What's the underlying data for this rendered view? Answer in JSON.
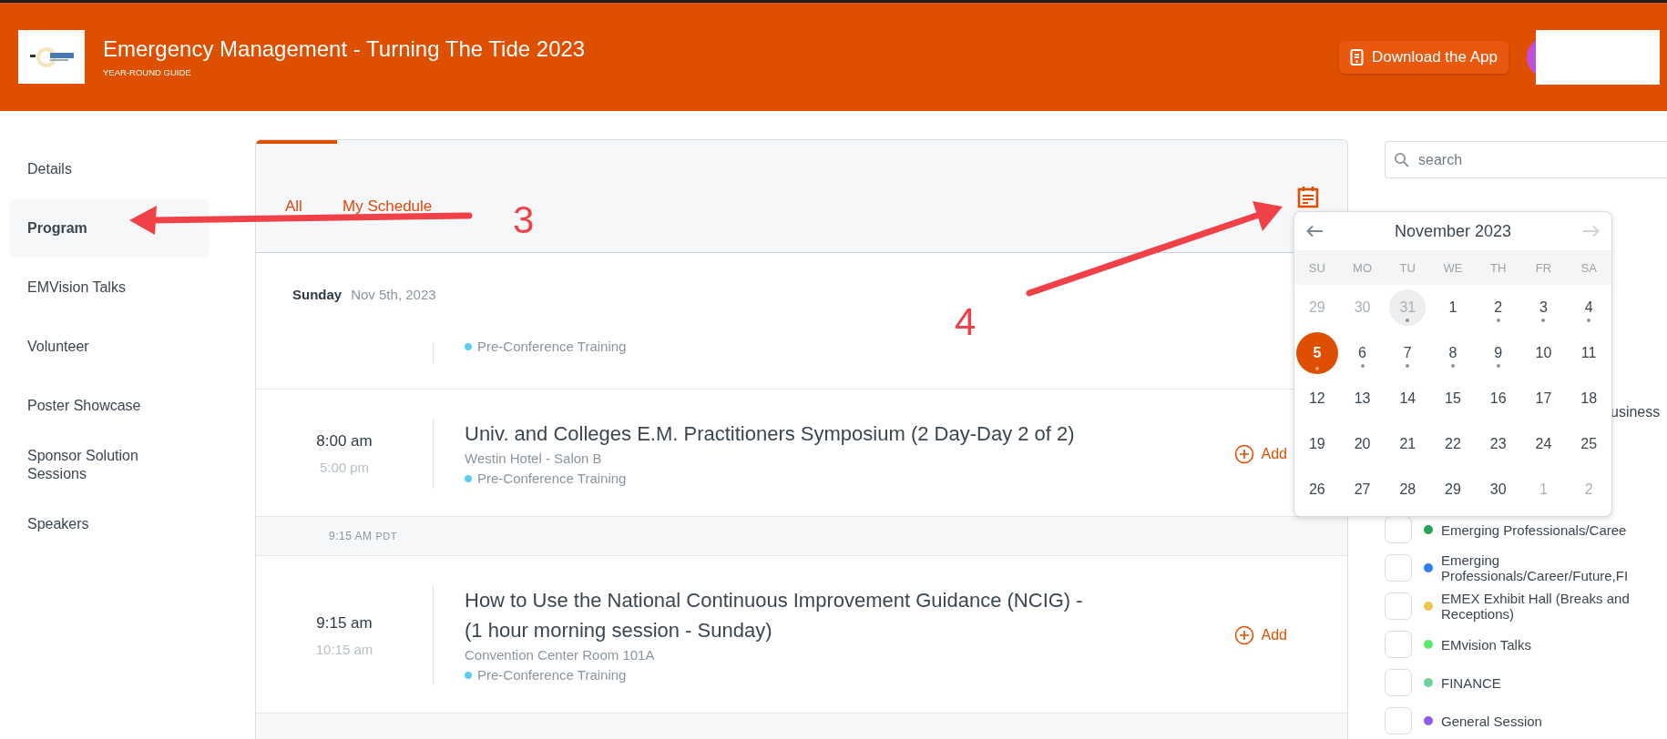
{
  "header": {
    "title": "Emergency Management - Turning The Tide 2023",
    "subtitle": "YEAR-ROUND GUIDE",
    "download_button": "Download the App"
  },
  "sidebar": {
    "items": [
      {
        "label": "Details",
        "selected": false
      },
      {
        "label": "Program",
        "selected": true
      },
      {
        "label": "EMVision Talks",
        "selected": false
      },
      {
        "label": "Volunteer",
        "selected": false
      },
      {
        "label": "Poster Showcase",
        "selected": false
      },
      {
        "label": "Sponsor Solution Sessions",
        "selected": false
      },
      {
        "label": "Speakers",
        "selected": false
      }
    ]
  },
  "tabs": [
    {
      "label": "All",
      "selected": true
    },
    {
      "label": "My Schedule",
      "selected": false
    }
  ],
  "schedule": {
    "day": "Sunday",
    "date": "Nov 5th, 2023",
    "items": [
      {
        "kind": "partial",
        "category": "Pre-Conference Training",
        "color": "#5bcfee"
      },
      {
        "kind": "session",
        "start": "8:00 am",
        "end": "5:00 pm",
        "title": "Univ. and Colleges E.M. Practitioners Symposium (2 Day-Day 2 of 2)",
        "location": "Westin Hotel - Salon B",
        "category": "Pre-Conference Training",
        "color": "#5bcfee",
        "add_label": "Add"
      },
      {
        "kind": "time_marker",
        "time": "9:15 AM",
        "zone": "PDT"
      },
      {
        "kind": "session",
        "start": "9:15 am",
        "end": "10:15 am",
        "title": "How to Use the National Continuous Improvement Guidance (NCIG) - (1 hour morning session - Sunday)",
        "location": "Convention Center Room 101A",
        "category": "Pre-Conference Training",
        "color": "#5bcfee",
        "add_label": "Add"
      }
    ]
  },
  "search": {
    "placeholder": "search"
  },
  "calendar": {
    "month": "November 2023",
    "prev_disabled": false,
    "next_disabled": true,
    "weekdays": [
      "SU",
      "MO",
      "TU",
      "WE",
      "TH",
      "FR",
      "SA"
    ],
    "weeks": [
      [
        {
          "label": "29",
          "muted": true,
          "event": false,
          "selected": false,
          "highlighted": false
        },
        {
          "label": "30",
          "muted": true,
          "event": false,
          "selected": false,
          "highlighted": false
        },
        {
          "label": "31",
          "muted": true,
          "event": true,
          "selected": false,
          "highlighted": true
        },
        {
          "label": "1",
          "muted": false,
          "event": false,
          "selected": false,
          "highlighted": false
        },
        {
          "label": "2",
          "muted": false,
          "event": true,
          "selected": false,
          "highlighted": false
        },
        {
          "label": "3",
          "muted": false,
          "event": true,
          "selected": false,
          "highlighted": false
        },
        {
          "label": "4",
          "muted": false,
          "event": true,
          "selected": false,
          "highlighted": false
        }
      ],
      [
        {
          "label": "5",
          "muted": false,
          "event": true,
          "selected": true,
          "highlighted": false
        },
        {
          "label": "6",
          "muted": false,
          "event": true,
          "selected": false,
          "highlighted": false
        },
        {
          "label": "7",
          "muted": false,
          "event": true,
          "selected": false,
          "highlighted": false
        },
        {
          "label": "8",
          "muted": false,
          "event": true,
          "selected": false,
          "highlighted": false
        },
        {
          "label": "9",
          "muted": false,
          "event": true,
          "selected": false,
          "highlighted": false
        },
        {
          "label": "10",
          "muted": false,
          "event": false,
          "selected": false,
          "highlighted": false
        },
        {
          "label": "11",
          "muted": false,
          "event": false,
          "selected": false,
          "highlighted": false
        }
      ],
      [
        {
          "label": "12",
          "muted": false,
          "event": false,
          "selected": false,
          "highlighted": false
        },
        {
          "label": "13",
          "muted": false,
          "event": false,
          "selected": false,
          "highlighted": false
        },
        {
          "label": "14",
          "muted": false,
          "event": false,
          "selected": false,
          "highlighted": false
        },
        {
          "label": "15",
          "muted": false,
          "event": false,
          "selected": false,
          "highlighted": false
        },
        {
          "label": "16",
          "muted": false,
          "event": false,
          "selected": false,
          "highlighted": false
        },
        {
          "label": "17",
          "muted": false,
          "event": false,
          "selected": false,
          "highlighted": false
        },
        {
          "label": "18",
          "muted": false,
          "event": false,
          "selected": false,
          "highlighted": false
        }
      ],
      [
        {
          "label": "19",
          "muted": false,
          "event": false,
          "selected": false,
          "highlighted": false
        },
        {
          "label": "20",
          "muted": false,
          "event": false,
          "selected": false,
          "highlighted": false
        },
        {
          "label": "21",
          "muted": false,
          "event": false,
          "selected": false,
          "highlighted": false
        },
        {
          "label": "22",
          "muted": false,
          "event": false,
          "selected": false,
          "highlighted": false
        },
        {
          "label": "23",
          "muted": false,
          "event": false,
          "selected": false,
          "highlighted": false
        },
        {
          "label": "24",
          "muted": false,
          "event": false,
          "selected": false,
          "highlighted": false
        },
        {
          "label": "25",
          "muted": false,
          "event": false,
          "selected": false,
          "highlighted": false
        }
      ],
      [
        {
          "label": "26",
          "muted": false,
          "event": false,
          "selected": false,
          "highlighted": false
        },
        {
          "label": "27",
          "muted": false,
          "event": false,
          "selected": false,
          "highlighted": false
        },
        {
          "label": "28",
          "muted": false,
          "event": false,
          "selected": false,
          "highlighted": false
        },
        {
          "label": "29",
          "muted": false,
          "event": false,
          "selected": false,
          "highlighted": false
        },
        {
          "label": "30",
          "muted": false,
          "event": false,
          "selected": false,
          "highlighted": false
        },
        {
          "label": "1",
          "muted": true,
          "event": false,
          "selected": false,
          "highlighted": false
        },
        {
          "label": "2",
          "muted": true,
          "event": false,
          "selected": false,
          "highlighted": false
        }
      ]
    ]
  },
  "filters": {
    "partial_label": "usiness",
    "items": [
      {
        "label": "Emerging Professionals/Caree",
        "color": "#22a35a",
        "checked": false
      },
      {
        "label": "Emerging Professionals/Career/Future,FI",
        "color": "#2f7df0",
        "checked": false
      },
      {
        "label": "EMEX Exhibit Hall (Breaks and Receptions)",
        "color": "#f0c34a",
        "checked": false
      },
      {
        "label": "EMvision Talks",
        "color": "#5ee86a",
        "checked": false
      },
      {
        "label": "FINANCE",
        "color": "#72d09a",
        "checked": false
      },
      {
        "label": "General Session",
        "color": "#8e5ae8",
        "checked": false
      }
    ]
  },
  "annotations": [
    {
      "label": "3"
    },
    {
      "label": "4"
    }
  ]
}
